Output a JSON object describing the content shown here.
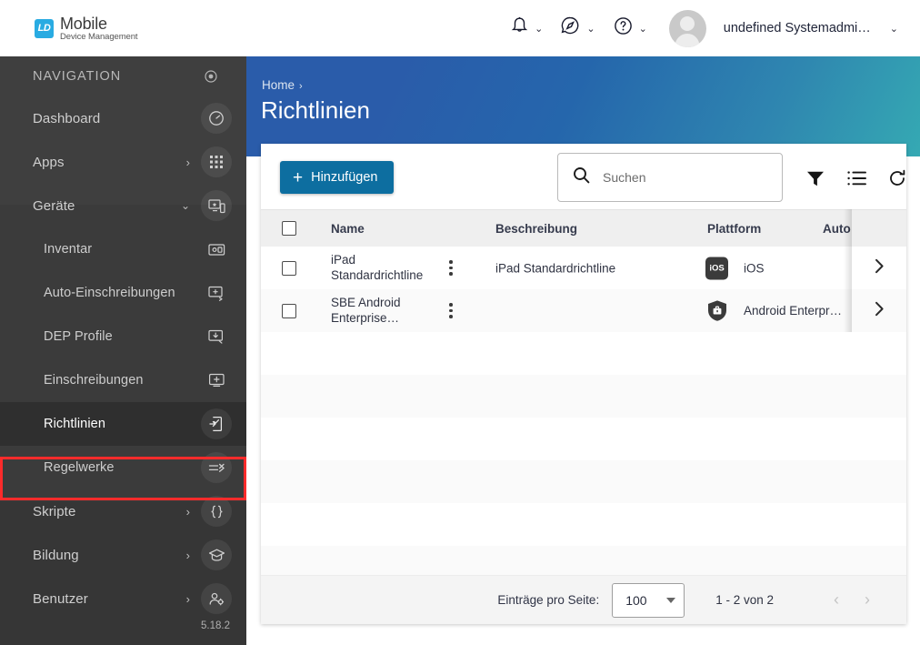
{
  "topbar": {
    "logo": {
      "mark": "LD",
      "title": "Mobile",
      "subtitle": "Device Management",
      "color": "#29abe2"
    },
    "actions": [
      {
        "name": "notifications",
        "icon": "bell-icon",
        "caret": "⌄"
      },
      {
        "name": "messages",
        "icon": "compass-icon",
        "caret": "⌄"
      },
      {
        "name": "help",
        "icon": "question-circle-icon",
        "caret": "⌄"
      }
    ],
    "user": {
      "name": "undefined Systemadmi…",
      "caret": "⌄"
    }
  },
  "sidebar": {
    "heading": "NAVIGATION",
    "heading_icon": "target-icon",
    "version": "5.18.2",
    "selection_color": "#fc2b2b",
    "items": [
      {
        "label": "Dashboard",
        "icon": "speedometer-icon",
        "arrow": "",
        "level": 0,
        "active": false
      },
      {
        "label": "Apps",
        "icon": "grid-icon",
        "arrow": "›",
        "level": 0,
        "active": false
      },
      {
        "label": "Geräte",
        "icon": "devices-icon",
        "arrow": "⌄",
        "level": 0,
        "active": false
      },
      {
        "label": "Inventar",
        "icon": "inventory-icon",
        "arrow": "",
        "level": 1,
        "active": false
      },
      {
        "label": "Auto-Einschreibungen",
        "icon": "auto-enroll-icon",
        "arrow": "",
        "level": 1,
        "active": false
      },
      {
        "label": "DEP Profile",
        "icon": "dep-download-icon",
        "arrow": "",
        "level": 1,
        "active": false
      },
      {
        "label": "Einschreibungen",
        "icon": "enroll-plus-icon",
        "arrow": "",
        "level": 1,
        "active": false
      },
      {
        "label": "Richtlinien",
        "icon": "policy-doc-icon",
        "arrow": "",
        "level": 1,
        "active": true
      },
      {
        "label": "Regelwerke",
        "icon": "rules-icon",
        "arrow": "",
        "level": 1,
        "active": false
      },
      {
        "label": "Skripte",
        "icon": "braces-icon",
        "arrow": "›",
        "level": 0,
        "active": false
      },
      {
        "label": "Bildung",
        "icon": "graduation-cap-icon",
        "arrow": "›",
        "level": 0,
        "active": false
      },
      {
        "label": "Benutzer",
        "icon": "user-gear-icon",
        "arrow": "›",
        "level": 0,
        "active": false
      }
    ]
  },
  "hero": {
    "breadcrumb": "Home",
    "breadcrumb_chevron": "›",
    "title": "Richtlinien"
  },
  "toolbar": {
    "add_label": "Hinzufügen",
    "add_plus": "+",
    "add_color": "#0d6ea0",
    "search_placeholder": "Suchen",
    "icons": {
      "filter": "filter-icon",
      "list": "list-view-icon",
      "refresh": "refresh-icon"
    }
  },
  "table": {
    "columns": [
      "Name",
      "Beschreibung",
      "Plattform",
      "Auto"
    ],
    "rows": [
      {
        "name": "iPad Standardrichtline",
        "description": "iPad Standardrichtline",
        "platform": "iOS",
        "platform_icon": "ios-badge",
        "platform_badge_text": "iOS"
      },
      {
        "name": "SBE Android Enterprise…",
        "description": "",
        "platform": "Android Enterpr…",
        "platform_icon": "android-enterprise-shield",
        "platform_badge_text": ""
      }
    ],
    "row_chevron": "›",
    "empty_row_count": 6
  },
  "footer": {
    "per_page_label": "Einträge pro Seite:",
    "per_page_value": "100",
    "range": "1 - 2 von 2",
    "prev": "‹",
    "next": "›"
  }
}
